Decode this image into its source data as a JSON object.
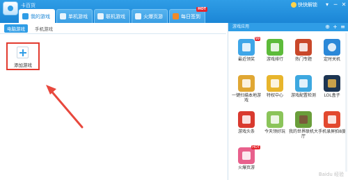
{
  "window": {
    "app_title": "卡百货"
  },
  "tabs": [
    {
      "label": "我的游戏",
      "color": "#2f9de6",
      "active": true
    },
    {
      "label": "单机游戏",
      "color": "#4bb0f2"
    },
    {
      "label": "联机游戏",
      "color": "#5aa0d8"
    },
    {
      "label": "火爆页游",
      "color": "#3a9ee3"
    },
    {
      "label": "每日签到",
      "color": "#f08a28",
      "badge": "HOT"
    }
  ],
  "top_right": {
    "unlock_label": "快快解锁",
    "controls": [
      "▾",
      "─",
      "✕"
    ]
  },
  "subtabs": [
    {
      "label": "电脑游戏",
      "active": true
    },
    {
      "label": "手机游戏"
    }
  ],
  "add_game": {
    "label": "添加游戏"
  },
  "right_panel": {
    "header": "游戏应用",
    "header_icons": [
      "⊕",
      "+",
      "≡"
    ],
    "apps": [
      {
        "label": "最近领奖",
        "color": "#3fa6e8",
        "icon": "location-icon",
        "badge": "99"
      },
      {
        "label": "游戏排行",
        "color": "#5dbb3a",
        "icon": "chart-icon"
      },
      {
        "label": "热门专题",
        "color": "#c9482a",
        "icon": "bird-icon"
      },
      {
        "label": "定时关机",
        "color": "#2b88d8",
        "icon": "clock-icon"
      },
      {
        "label": "一键扫描本地游戏",
        "color": "#e0a733",
        "icon": "scan-icon"
      },
      {
        "label": "特权中心",
        "color": "#e8b52c",
        "icon": "vip-icon"
      },
      {
        "label": "游戏配置检测",
        "color": "#3da8e0",
        "icon": "check-icon"
      },
      {
        "label": "LOL盒子",
        "color": "#1d3552",
        "icon": "lol-icon"
      },
      {
        "label": "游戏头条",
        "color": "#d93a2f",
        "icon": "news-icon"
      },
      {
        "label": "今天领好玩",
        "color": "#8bc45a",
        "icon": "gift-icon"
      },
      {
        "label": "我的世界联机大厅",
        "color": "#6a9e3a",
        "icon": "minecraft-icon"
      },
      {
        "label": "手机录屏拍8度",
        "color": "#e2492f",
        "icon": "phone-icon"
      },
      {
        "label": "火爆页游",
        "color": "#e8608c",
        "icon": "game-icon",
        "badge": "HOT"
      }
    ]
  },
  "watermark": "Baidu 经验"
}
